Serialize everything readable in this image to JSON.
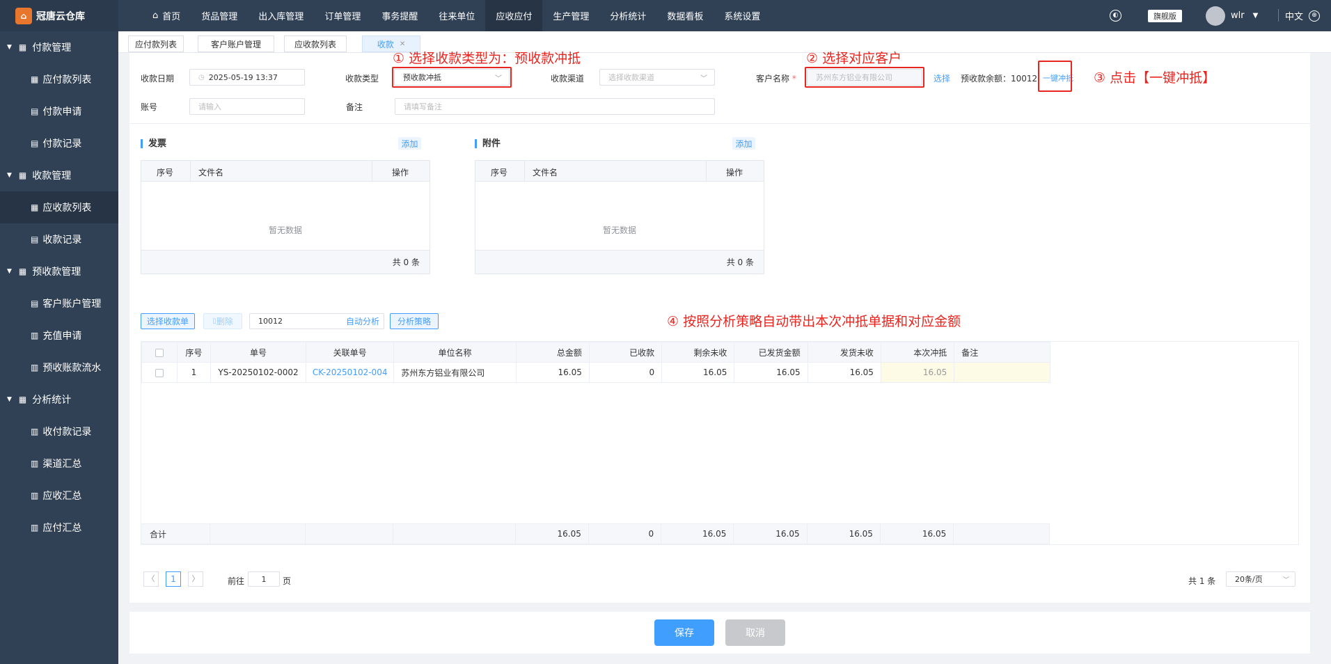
{
  "app": {
    "name": "冠唐云仓库"
  },
  "sidebar": {
    "groups": [
      {
        "label": "付款管理",
        "items": [
          "应付款列表",
          "付款申请",
          "付款记录"
        ]
      },
      {
        "label": "收款管理",
        "items": [
          "应收款列表",
          "收款记录"
        ]
      },
      {
        "label": "预收款管理",
        "items": [
          "客户账户管理",
          "充值申请",
          "预收账款流水"
        ]
      },
      {
        "label": "分析统计",
        "items": [
          "收付款记录",
          "渠道汇总",
          "应收汇总",
          "应付汇总"
        ]
      }
    ]
  },
  "topnav": {
    "items": [
      "首页",
      "货品管理",
      "出入库管理",
      "订单管理",
      "事务提醒",
      "往来单位",
      "应收应付",
      "生产管理",
      "分析统计",
      "数据看板",
      "系统设置"
    ],
    "edition": "旗舰版",
    "user": "wlr",
    "language": "中文"
  },
  "tabs": [
    "应付款列表",
    "客户账户管理",
    "应收款列表",
    "收款"
  ],
  "form": {
    "date_label": "收款日期",
    "date_value": "2025-05-19 13:37",
    "type_label": "收款类型",
    "type_value": "预收款冲抵",
    "channel_label": "收款渠道",
    "channel_placeholder": "选择收款渠道",
    "customer_label": "客户名称",
    "customer_value": "苏州东方铝业有限公司",
    "select_link": "选择",
    "balance_label": "预收款余额：10012",
    "offset_link": "一键冲抵",
    "account_label": "账号",
    "account_placeholder": "请输入",
    "note_label": "备注",
    "note_placeholder": "请填写备注"
  },
  "annotations": {
    "a1": "① 选择收款类型为：预收款冲抵",
    "a2": "② 选择对应客户",
    "a3": "③ 点击【一键冲抵】",
    "a4": "④ 按照分析策略自动带出本次冲抵单据和对应金额"
  },
  "invoice": {
    "title": "发票",
    "add": "添加",
    "cols": [
      "序号",
      "文件名",
      "操作"
    ],
    "empty": "暂无数据",
    "total": "共 0 条"
  },
  "attachment": {
    "title": "附件",
    "add": "添加",
    "cols": [
      "序号",
      "文件名",
      "操作"
    ],
    "empty": "暂无数据",
    "total": "共 0 条"
  },
  "toolbar": {
    "select_btn": "选择收款单",
    "delete_btn": "删除",
    "amount_value": "10012",
    "auto_analyze": "自动分析",
    "strategy_btn": "分析策略"
  },
  "table": {
    "headers": [
      "序号",
      "单号",
      "关联单号",
      "单位名称",
      "总金额",
      "已收款",
      "剩余未收",
      "已发货金额",
      "发货未收",
      "本次冲抵",
      "备注"
    ],
    "rows": [
      [
        "1",
        "YS-20250102-0002",
        "CK-20250102-004",
        "苏州东方铝业有限公司",
        "16.05",
        "0",
        "16.05",
        "16.05",
        "16.05",
        "16.05",
        ""
      ]
    ],
    "totals_label": "合计",
    "totals": [
      "16.05",
      "0",
      "16.05",
      "16.05",
      "16.05",
      "16.05"
    ]
  },
  "pagination": {
    "current_page": "1",
    "goto_prefix": "前往",
    "goto_value": "1",
    "goto_suffix": "页",
    "total": "共 1 条",
    "page_size": "20条/页"
  },
  "actions": {
    "save": "保存",
    "cancel": "取消"
  },
  "colors": {
    "accent": "#409eff",
    "sidebar": "#304156",
    "annotation": "#e8251f"
  }
}
